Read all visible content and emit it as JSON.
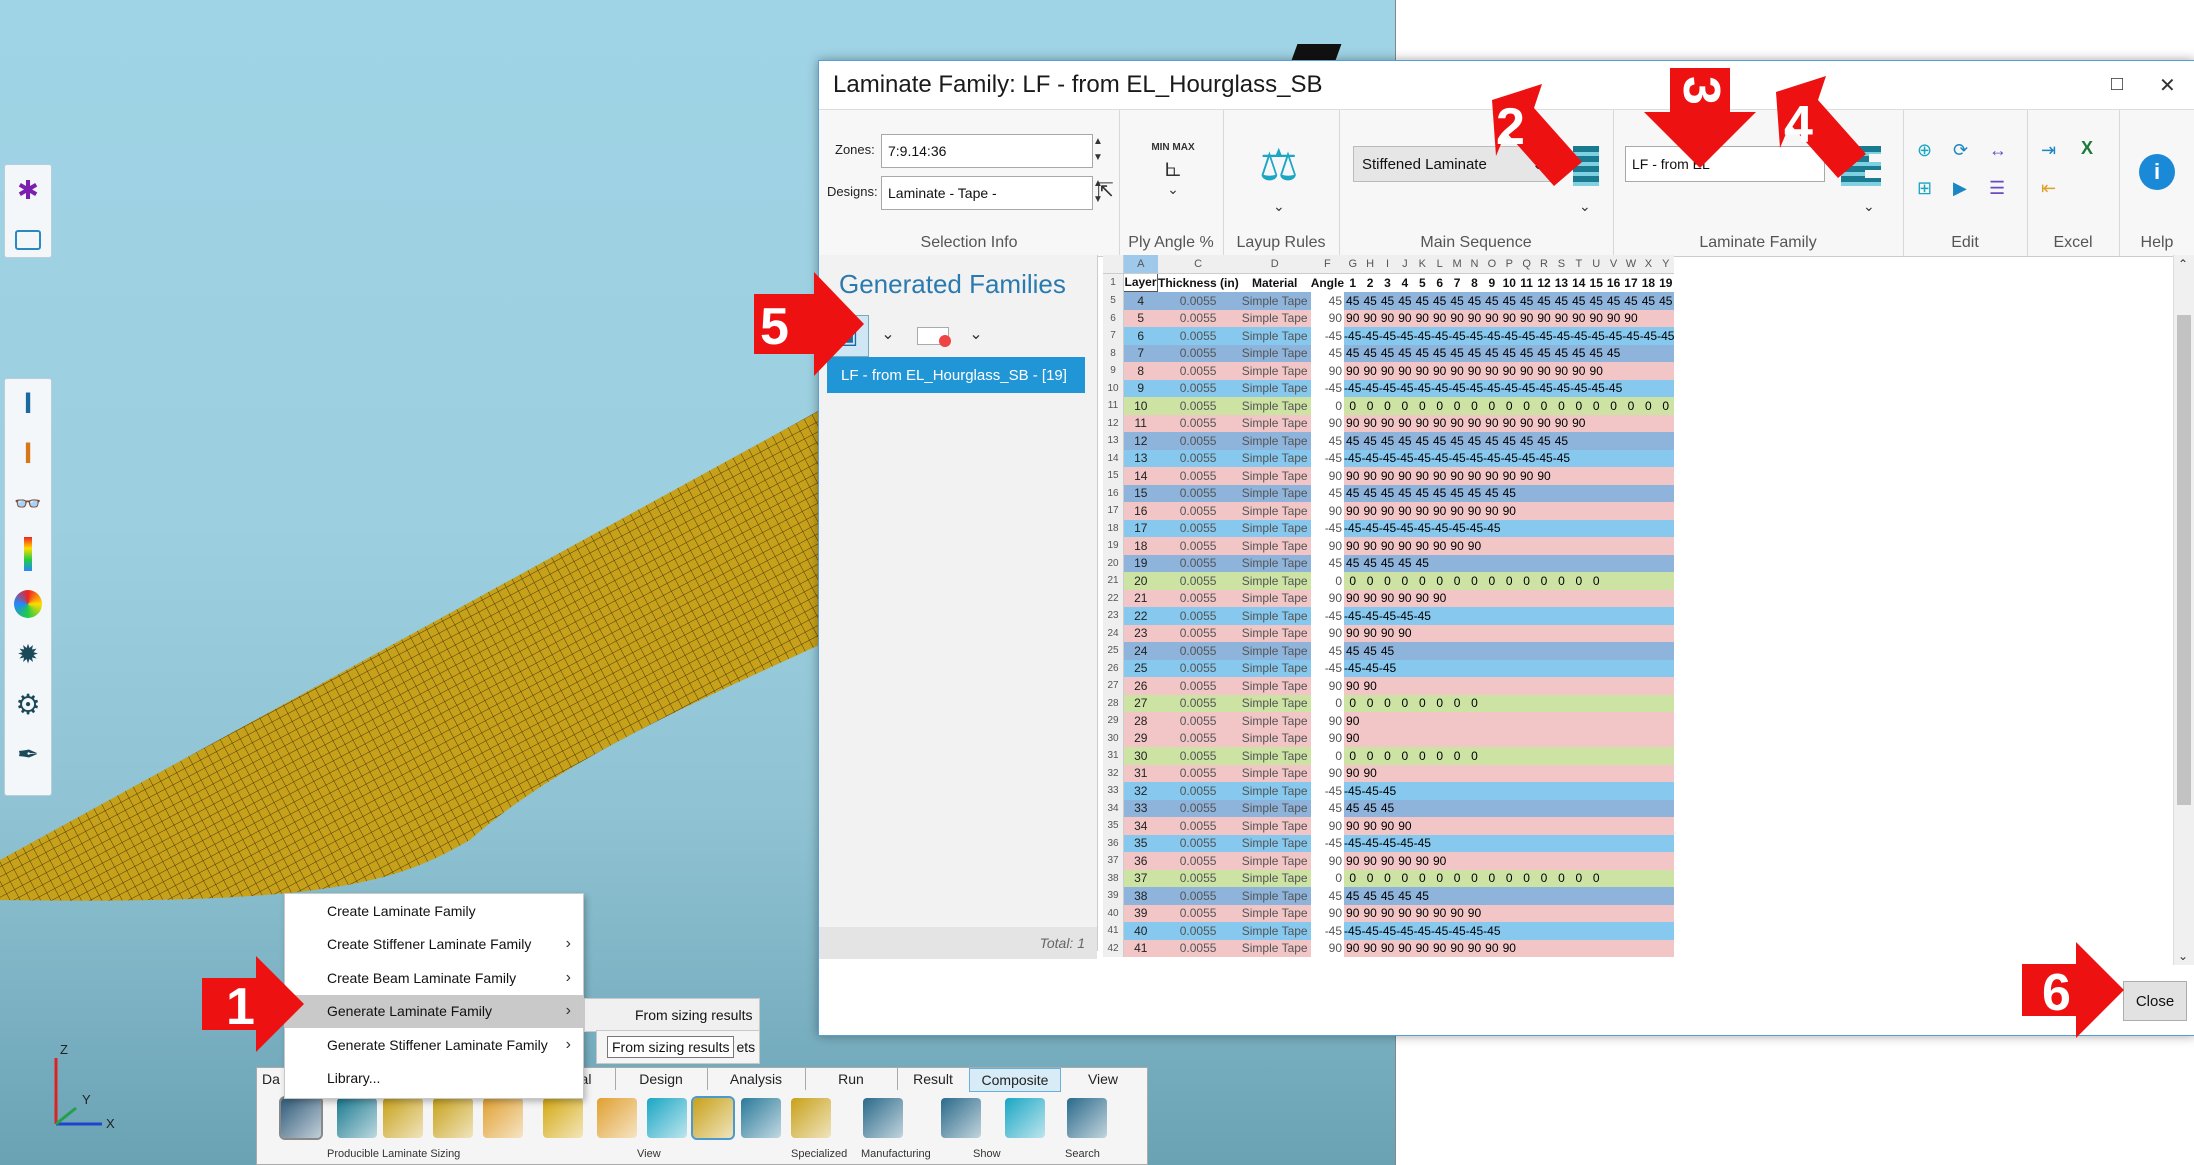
{
  "dialog": {
    "title": "Laminate Family: LF - from EL_Hourglass_SB",
    "minimize": "□",
    "close": "✕",
    "close_button": "Close"
  },
  "ribbon": {
    "zones_label": "Zones:",
    "zones_value": "7:9.14:36",
    "designs_label": "Designs:",
    "designs_value": "Laminate  -  Tape  -",
    "selection_info": "Selection Info",
    "ply_angle": "Ply Angle %",
    "layup_rules": "Layup Rules",
    "main_sequence": "Main Sequence",
    "main_sequence_value": "Stiffened Laminate",
    "laminate_family": "Laminate Family",
    "laminate_family_value": "LF - from EL",
    "edit": "Edit",
    "excel": "Excel",
    "help": "Help",
    "minmax_icon_text": "MIN MAX"
  },
  "families_panel": {
    "title": "Generated Families",
    "items": [
      "LF - from EL_Hourglass_SB - [19]"
    ],
    "total": "Total: 1"
  },
  "grid": {
    "col_letters": [
      "A",
      "C",
      "D",
      "F",
      "G",
      "H",
      "I",
      "J",
      "K",
      "L",
      "M",
      "N",
      "O",
      "P",
      "Q",
      "R",
      "S",
      "T",
      "U",
      "V",
      "W",
      "X",
      "Y"
    ],
    "headers": [
      "Layer",
      "Thickness (in)",
      "Material",
      "Angle",
      "1",
      "2",
      "3",
      "4",
      "5",
      "6",
      "7",
      "8",
      "9",
      "10",
      "11",
      "12",
      "13",
      "14",
      "15",
      "16",
      "17",
      "18",
      "19"
    ],
    "thickness": "0.0055",
    "material": "Simple Tape",
    "layers": [
      {
        "layer": 4,
        "angle": 45,
        "count": 19
      },
      {
        "layer": 5,
        "angle": 90,
        "count": 17
      },
      {
        "layer": 6,
        "angle": -45,
        "count": 19
      },
      {
        "layer": 7,
        "angle": 45,
        "count": 16
      },
      {
        "layer": 8,
        "angle": 90,
        "count": 15
      },
      {
        "layer": 9,
        "angle": -45,
        "count": 16
      },
      {
        "layer": 10,
        "angle": 0,
        "count": 19
      },
      {
        "layer": 11,
        "angle": 90,
        "count": 14
      },
      {
        "layer": 12,
        "angle": 45,
        "count": 13
      },
      {
        "layer": 13,
        "angle": -45,
        "count": 13
      },
      {
        "layer": 14,
        "angle": 90,
        "count": 12
      },
      {
        "layer": 15,
        "angle": 45,
        "count": 10
      },
      {
        "layer": 16,
        "angle": 90,
        "count": 10
      },
      {
        "layer": 17,
        "angle": -45,
        "count": 9
      },
      {
        "layer": 18,
        "angle": 90,
        "count": 8
      },
      {
        "layer": 19,
        "angle": 45,
        "count": 5
      },
      {
        "layer": 20,
        "angle": 0,
        "count": 15
      },
      {
        "layer": 21,
        "angle": 90,
        "count": 6
      },
      {
        "layer": 22,
        "angle": -45,
        "count": 5
      },
      {
        "layer": 23,
        "angle": 90,
        "count": 4
      },
      {
        "layer": 24,
        "angle": 45,
        "count": 3
      },
      {
        "layer": 25,
        "angle": -45,
        "count": 3
      },
      {
        "layer": 26,
        "angle": 90,
        "count": 2
      },
      {
        "layer": 27,
        "angle": 0,
        "count": 8
      },
      {
        "layer": 28,
        "angle": 90,
        "count": 1
      },
      {
        "layer": 29,
        "angle": 90,
        "count": 1
      },
      {
        "layer": 30,
        "angle": 0,
        "count": 8
      },
      {
        "layer": 31,
        "angle": 90,
        "count": 2
      },
      {
        "layer": 32,
        "angle": -45,
        "count": 3
      },
      {
        "layer": 33,
        "angle": 45,
        "count": 3
      },
      {
        "layer": 34,
        "angle": 90,
        "count": 4
      },
      {
        "layer": 35,
        "angle": -45,
        "count": 5
      },
      {
        "layer": 36,
        "angle": 90,
        "count": 6
      },
      {
        "layer": 37,
        "angle": 0,
        "count": 15
      },
      {
        "layer": 38,
        "angle": 45,
        "count": 5
      },
      {
        "layer": 39,
        "angle": 90,
        "count": 8
      },
      {
        "layer": 40,
        "angle": -45,
        "count": 9
      },
      {
        "layer": 41,
        "angle": 90,
        "count": 10
      }
    ],
    "colors": {
      "45": "#8fb4dc",
      "90": "#f2c6c6",
      "-45": "#86c8ee",
      "0": "#cce3a4"
    }
  },
  "context_menu": {
    "items": [
      {
        "label": "Create Laminate Family",
        "arrow": ""
      },
      {
        "label": "Create Stiffener Laminate Family",
        "arrow": "›"
      },
      {
        "label": "Create Beam Laminate Family",
        "arrow": "›"
      },
      {
        "label": "Generate Laminate Family",
        "arrow": "›"
      },
      {
        "label": "Generate Stiffener Laminate Family",
        "arrow": "›"
      },
      {
        "label": "Library...",
        "arrow": ""
      }
    ],
    "submenu1": "From sizing results",
    "submenu2": "From sizing results",
    "submenu2_tail": "ets"
  },
  "app_ribbon": {
    "tabs": [
      "Da",
      "al",
      "Design",
      "Analysis",
      "Run",
      "Result",
      "Composite",
      "View"
    ],
    "groups": [
      "Producible Laminate Sizing",
      "View",
      "Specialized",
      "Manufacturing",
      "Show",
      "Search"
    ]
  },
  "callouts": [
    "1",
    "2",
    "3",
    "4",
    "5",
    "6"
  ],
  "axis": {
    "z": "Z",
    "y": "Y",
    "x": "X"
  }
}
